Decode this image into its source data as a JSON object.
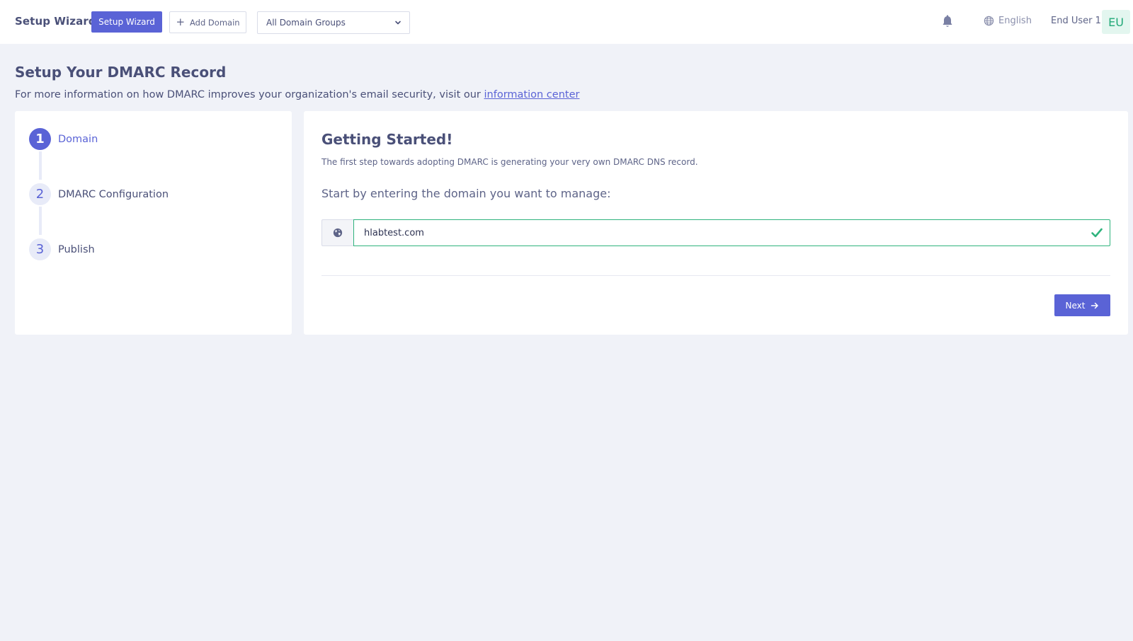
{
  "topbar": {
    "brand": "Setup Wizard",
    "wizard_button": "Setup Wizard",
    "add_domain_button": "Add Domain",
    "domain_group_select": "All Domain Groups",
    "language": "English",
    "user_name": "End User 1",
    "avatar_initials": "EU"
  },
  "header": {
    "title": "Setup Your DMARC Record",
    "subtitle_prefix": "For more information on how DMARC improves your organization's email security, visit our ",
    "subtitle_link": "information center"
  },
  "steps": [
    {
      "number": "1",
      "label": "Domain",
      "active": true
    },
    {
      "number": "2",
      "label": "DMARC Configuration",
      "active": false
    },
    {
      "number": "3",
      "label": "Publish",
      "active": false
    }
  ],
  "main": {
    "title": "Getting Started!",
    "description": "The first step towards adopting DMARC is generating your very own DMARC DNS record.",
    "prompt": "Start by entering the domain you want to manage:",
    "domain_value": "hlabtest.com",
    "domain_valid": true,
    "next_button": "Next"
  },
  "colors": {
    "accent": "#5a63d6",
    "success": "#2fb37d",
    "background": "#f0f2f8",
    "text": "#4a5078"
  },
  "icons": {
    "topbar": [
      "plus-icon",
      "chevron-down-icon",
      "bell-icon",
      "globe-icon"
    ],
    "domain_addon": "globe-icon",
    "validation": "check-icon",
    "next": "arrow-right-icon"
  }
}
